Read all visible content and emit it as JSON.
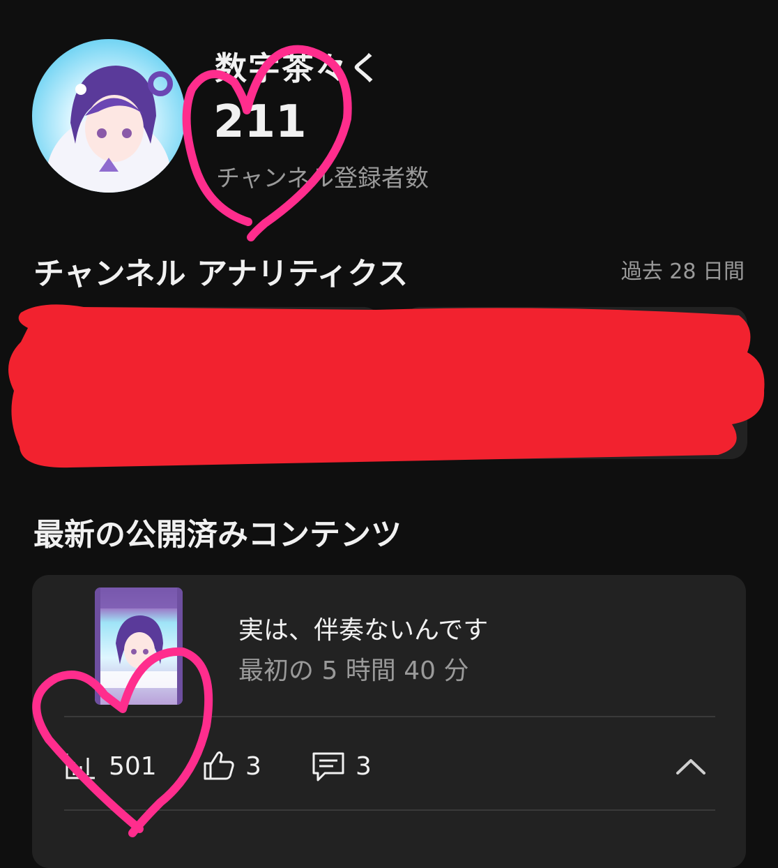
{
  "header": {
    "channel_name": "数字茶々く",
    "subscriber_count": "211",
    "subscriber_label": "チャンネル登録者数"
  },
  "analytics": {
    "title": "チャンネル アナリティクス",
    "period": "過去 28 日間"
  },
  "latest": {
    "title": "最新の公開済みコンテンツ",
    "video": {
      "title": "実は、伴奏ないんです",
      "subtitle": "最初の 5 時間 40 分",
      "views": "501",
      "likes": "3",
      "comments": "3"
    }
  },
  "colors": {
    "background": "#0f0f0f",
    "card": "#222222",
    "muted_text": "#9a9a9a",
    "annotation_heart": "#ff2d8d",
    "annotation_redaction": "#f2222f"
  },
  "icons": [
    "bar-chart-icon",
    "thumbs-up-icon",
    "comment-icon",
    "chevron-up-icon"
  ]
}
